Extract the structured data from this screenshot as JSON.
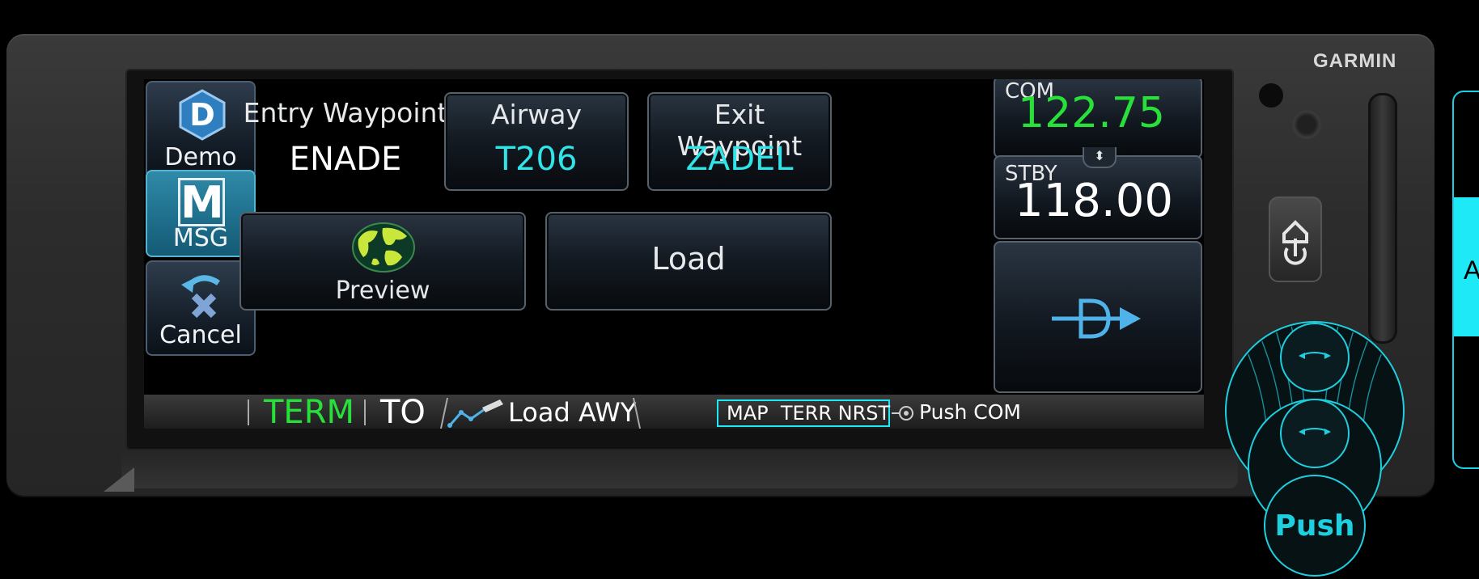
{
  "device": {
    "brand": "GARMIN"
  },
  "left_buttons": [
    {
      "label": "Demo",
      "badge": "D"
    },
    {
      "label": "MSG",
      "badge": "M"
    },
    {
      "label": "Cancel"
    }
  ],
  "airway": {
    "entry_label": "Entry Waypoint",
    "entry_value": "ENADE",
    "airway_label": "Airway",
    "airway_value": "T206",
    "exit_label": "Exit Waypoint",
    "exit_value": "ZADEL"
  },
  "actions": {
    "preview_label": "Preview",
    "load_label": "Load"
  },
  "com": {
    "active_label": "COM",
    "active_freq": "122.75",
    "standby_label": "STBY",
    "standby_freq": "118.00",
    "swap_glyph": "⬍",
    "direct_to_icon": "direct-to-icon"
  },
  "status_bar": {
    "phase": "TERM",
    "to_label": "TO",
    "leg_label": "Load AWY",
    "softkeys": "MAP  TERR NRST",
    "knob_hint": "Push COM"
  },
  "knob": {
    "push_label": "Push"
  },
  "side_panel": {
    "text": "A"
  },
  "colors": {
    "active_freq": "#28e03a",
    "value_cyan": "#30e4e8",
    "phase_green": "#28e03a",
    "highlight_cyan": "#1ee9f7"
  }
}
